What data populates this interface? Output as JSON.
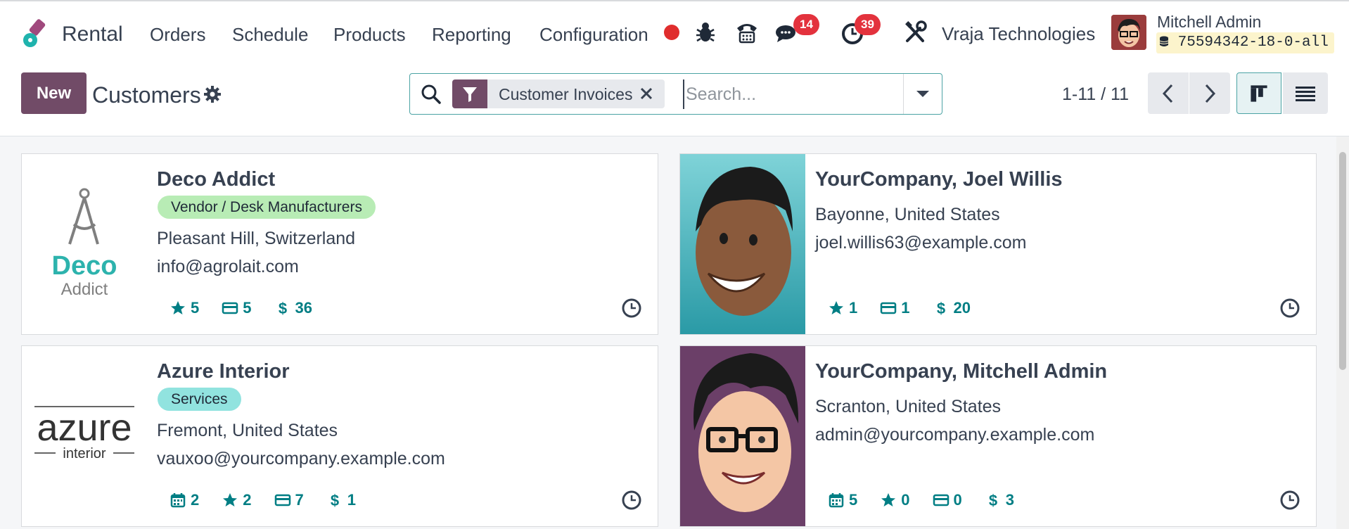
{
  "navbar": {
    "app_name": "Rental",
    "menu": [
      "Orders",
      "Schedule",
      "Products",
      "Reporting",
      "Configuration"
    ],
    "messages_count": "14",
    "activities_count": "39",
    "company": "Vraja Technologies",
    "user_name": "Mitchell Admin",
    "database": "75594342-18-0-all"
  },
  "control_panel": {
    "new_label": "New",
    "title": "Customers",
    "facet_label": "Customer Invoices",
    "search_placeholder": "Search...",
    "pager": "1-11 / 11"
  },
  "cards": [
    {
      "name": "Deco Addict",
      "tag": "Vendor / Desk Manufacturers",
      "location": "Pleasant Hill, Switzerland",
      "email": "info@agrolait.com",
      "stats": [
        {
          "icon": "star-icon",
          "value": "5"
        },
        {
          "icon": "credit-card-icon",
          "value": "5"
        },
        {
          "icon": "dollar-icon",
          "value": "36"
        }
      ],
      "logo_text": [
        "Deco",
        "Addict"
      ]
    },
    {
      "name": "YourCompany, Joel Willis",
      "tag": "",
      "location": "Bayonne, United States",
      "email": "joel.willis63@example.com",
      "stats": [
        {
          "icon": "star-icon",
          "value": "1"
        },
        {
          "icon": "credit-card-icon",
          "value": "1"
        },
        {
          "icon": "dollar-icon",
          "value": "20"
        }
      ]
    },
    {
      "name": "Azure Interior",
      "tag": "Services",
      "location": "Fremont, United States",
      "email": "vauxoo@yourcompany.example.com",
      "stats": [
        {
          "icon": "calendar-icon",
          "value": "2"
        },
        {
          "icon": "star-icon",
          "value": "2"
        },
        {
          "icon": "credit-card-icon",
          "value": "7"
        },
        {
          "icon": "dollar-icon",
          "value": "1"
        }
      ],
      "logo_text": [
        "azure",
        "interior"
      ]
    },
    {
      "name": "YourCompany, Mitchell Admin",
      "tag": "",
      "location": "Scranton, United States",
      "email": "admin@yourcompany.example.com",
      "stats": [
        {
          "icon": "calendar-icon",
          "value": "5"
        },
        {
          "icon": "star-icon",
          "value": "0"
        },
        {
          "icon": "credit-card-icon",
          "value": "0"
        },
        {
          "icon": "dollar-icon",
          "value": "3"
        }
      ]
    }
  ],
  "colors": {
    "brand": "#714b67",
    "accent": "#017e84",
    "badge": "#e3323d",
    "tag_vendor": "#b8ecb5",
    "tag_services": "#91e3df"
  }
}
